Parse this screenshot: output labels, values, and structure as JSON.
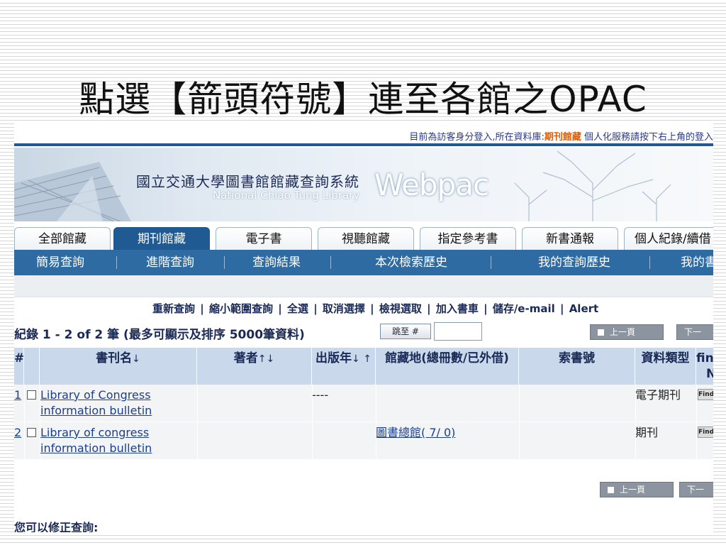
{
  "slide": {
    "title": "點選【箭頭符號】連至各館之OPAC"
  },
  "topinfo": {
    "prefix": "目前為訪客身分登入,所在資料庫:",
    "highlight": "期刊館藏",
    "suffix": "個人化服務請按下右上角的登入"
  },
  "banner": {
    "cn": "國立交通大學圖書館館藏查詢系統",
    "en": "National Chiao Tung Library",
    "web": "Webpac"
  },
  "tabs": [
    "全部館藏",
    "期刊館藏",
    "電子書",
    "視聽館藏",
    "指定參考書",
    "新書通報",
    "個人紀錄/續借"
  ],
  "subnav": [
    "簡易查詢",
    "進階查詢",
    "查詢結果",
    "本次檢索歷史",
    "我的查詢歷史",
    "我的書"
  ],
  "actions": [
    "重新查詢",
    "縮小範圍查詢",
    "全選",
    "取消選擇",
    "檢視選取",
    "加入書車",
    "儲存/e-mail",
    "Alert"
  ],
  "action_sep": "|",
  "results": {
    "count": "紀錄 1 - 2 of 2 筆 (最多可顯示及排序 5000筆資料)",
    "jump": "跳至 #",
    "prev": "上一頁",
    "next": "下一"
  },
  "table": {
    "headers": {
      "num": "#",
      "title": "書刊名",
      "title_sort": "↓",
      "author": "著者",
      "author_sort": "↑↓",
      "year": "出版年",
      "year_sort": "↓ ↑",
      "holdings": "館藏地(總冊數/已外借)",
      "callno": "索書號",
      "type": "資料類型",
      "find": "fin",
      "find2": "N"
    },
    "rows": [
      {
        "num": "1",
        "title1": "Library of Congress",
        "title2": "information bulletin",
        "author": "",
        "year": "----",
        "holdings": "",
        "callno": "",
        "type": "電子期刊",
        "find": "Find"
      },
      {
        "num": "2",
        "title1": "Library of congress",
        "title2": "information bulletin",
        "author": "",
        "year": "",
        "holdings": "圖書總館( 7/ 0)",
        "callno": "",
        "type": "期刊",
        "find": "Find"
      }
    ]
  },
  "bottom": {
    "text": "您可以修正查詢:"
  }
}
